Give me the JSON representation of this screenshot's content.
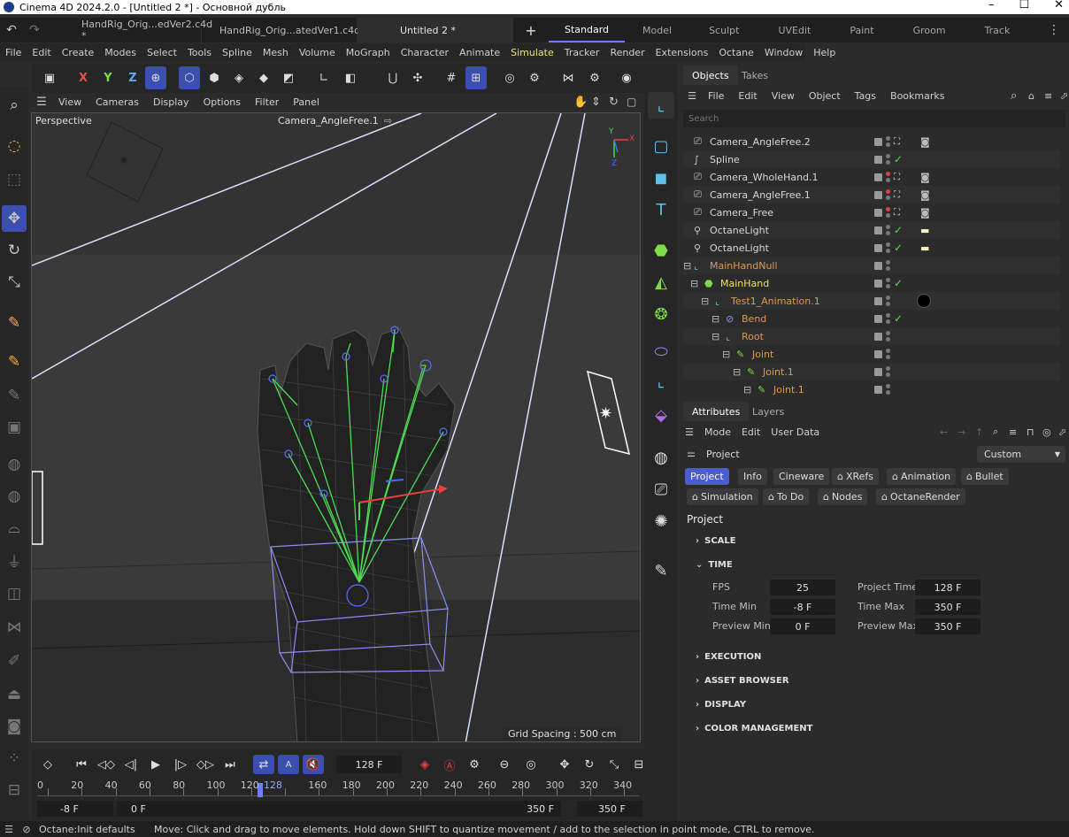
{
  "window": {
    "title": "Cinema 4D 2024.2.0 - [Untitled 2 *] - Основной дубль",
    "minimize": "–",
    "maximize": "☐",
    "close": "✕"
  },
  "tabs": {
    "docs": [
      {
        "label": "HandRig_Orig...edVer2.c4d *"
      },
      {
        "label": "HandRig_Orig...atedVer1.c4d"
      },
      {
        "label": "Untitled 2 *"
      }
    ],
    "add": "+",
    "layouts": [
      "Standard",
      "Model",
      "Sculpt",
      "UVEdit",
      "Paint",
      "Groom",
      "Track"
    ],
    "active_layout": "Standard"
  },
  "menu": [
    "File",
    "Edit",
    "Create",
    "Modes",
    "Select",
    "Tools",
    "Spline",
    "Mesh",
    "Volume",
    "MoGraph",
    "Character",
    "Animate",
    "Simulate",
    "Tracker",
    "Render",
    "Extensions",
    "Octane",
    "Window",
    "Help"
  ],
  "highlight_menu": "Simulate",
  "toolbar": {
    "x": "X",
    "y": "Y",
    "z": "Z"
  },
  "viewport": {
    "menu": [
      "View",
      "Cameras",
      "Display",
      "Options",
      "Filter",
      "Panel"
    ],
    "name": "Perspective",
    "camera": "Camera_AngleFree.1",
    "grid_spacing": "Grid Spacing : 500 cm",
    "axis": {
      "x": "X",
      "y": "Y",
      "z": "Z"
    }
  },
  "objects_panel": {
    "tabs": [
      "Objects",
      "Takes"
    ],
    "menu": [
      "File",
      "Edit",
      "View",
      "Object",
      "Tags",
      "Bookmarks"
    ],
    "search_placeholder": "Search",
    "rows": [
      {
        "name": "Camera_AngleFree.2",
        "icon": "camera-icon",
        "color": "normal",
        "red": false,
        "check": false,
        "tag": "camera"
      },
      {
        "name": "Spline",
        "icon": "spline-icon",
        "color": "normal",
        "red": false,
        "check": true,
        "tag": ""
      },
      {
        "name": "Camera_WholeHand.1",
        "icon": "camera-icon",
        "color": "normal",
        "red": true,
        "check": false,
        "tag": "camera"
      },
      {
        "name": "Camera_AngleFree.1",
        "icon": "camera-icon",
        "color": "normal",
        "red": true,
        "check": false,
        "tag": "camera"
      },
      {
        "name": "Camera_Free",
        "icon": "camera-icon",
        "color": "normal",
        "red": true,
        "check": false,
        "tag": "camera"
      },
      {
        "name": "OctaneLight",
        "icon": "light-icon",
        "color": "normal",
        "red": false,
        "check": true,
        "tag": "light"
      },
      {
        "name": "OctaneLight",
        "icon": "light-icon",
        "color": "normal",
        "red": false,
        "check": true,
        "tag": "light"
      },
      {
        "name": "MainHandNull",
        "icon": "null-icon",
        "color": "orange",
        "red": false,
        "check": false,
        "tag": ""
      },
      {
        "name": "MainHand",
        "icon": "mesh-icon",
        "color": "yellow",
        "red": false,
        "check": true,
        "tag": ""
      },
      {
        "name": "Test1_Animation.1",
        "icon": "null-icon",
        "color": "orange",
        "red": false,
        "check": false,
        "tag": "material"
      },
      {
        "name": "Bend",
        "icon": "bend-icon",
        "color": "orange",
        "red": false,
        "check": true,
        "tag": ""
      },
      {
        "name": "Root",
        "icon": "null-icon",
        "color": "orange",
        "red": false,
        "check": false,
        "tag": ""
      },
      {
        "name": "Joint",
        "icon": "joint-icon",
        "color": "orange",
        "red": false,
        "check": false,
        "tag": ""
      },
      {
        "name": "Joint.1",
        "icon": "joint-icon",
        "color": "orange",
        "red": false,
        "check": false,
        "tag": ""
      },
      {
        "name": "Joint.1",
        "icon": "joint-icon",
        "color": "orange",
        "red": false,
        "check": false,
        "tag": ""
      }
    ]
  },
  "attributes_panel": {
    "tabs": [
      "Attributes",
      "Layers"
    ],
    "menu": [
      "Mode",
      "Edit",
      "User Data"
    ],
    "object_label": "Project",
    "preset": "Custom",
    "chips_row1": [
      "Project",
      "Info",
      "Cineware",
      "XRefs",
      "Animation",
      "Bullet"
    ],
    "chips_row2": [
      "Simulation",
      "To Do",
      "Nodes",
      "OctaneRender"
    ],
    "heading": "Project",
    "sections": {
      "scale": "SCALE",
      "time": "TIME",
      "execution": "EXECUTION",
      "asset": "ASSET BROWSER",
      "display": "DISPLAY",
      "color": "COLOR MANAGEMENT"
    },
    "fields": {
      "fps_label": "FPS",
      "fps": "25",
      "project_time_label": "Project Time",
      "project_time": "128 F",
      "time_min_label": "Time Min",
      "time_min": "-8 F",
      "time_max_label": "Time Max",
      "time_max": "350 F",
      "preview_min_label": "Preview Min",
      "preview_min": "0 F",
      "preview_max_label": "Preview Max",
      "preview_max": "350 F"
    }
  },
  "timeline": {
    "current_frame": "128 F",
    "ticks": [
      "0",
      "20",
      "40",
      "60",
      "80",
      "100",
      "120",
      "128",
      "160",
      "180",
      "200",
      "220",
      "240",
      "260",
      "280",
      "300",
      "320",
      "340"
    ],
    "range_start": "-8 F",
    "preview_start": "0 F",
    "preview_end": "350 F",
    "range_end": "350 F"
  },
  "status": {
    "left": "Octane:Init defaults",
    "message": "Move: Click and drag to move elements. Hold down SHIFT to quantize movement / add to the selection in point mode, CTRL to remove."
  },
  "colors": {
    "accent": "#3b4fb0",
    "highlight": "#f1e37a",
    "object_orange": "#e09a4a",
    "skeleton": "#4ddb55"
  }
}
